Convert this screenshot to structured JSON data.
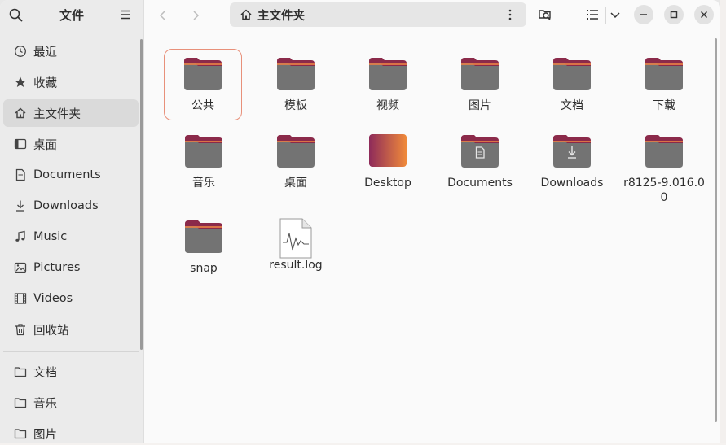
{
  "sidebar": {
    "title": "文件",
    "places": [
      {
        "label": "最近",
        "icon": "clock-icon"
      },
      {
        "label": "收藏",
        "icon": "star-icon"
      },
      {
        "label": "主文件夹",
        "icon": "home-icon",
        "active": true
      },
      {
        "label": "桌面",
        "icon": "desktop-icon"
      },
      {
        "label": "Documents",
        "icon": "document-icon"
      },
      {
        "label": "Downloads",
        "icon": "download-icon"
      },
      {
        "label": "Music",
        "icon": "music-icon"
      },
      {
        "label": "Pictures",
        "icon": "picture-icon"
      },
      {
        "label": "Videos",
        "icon": "video-icon"
      },
      {
        "label": "回收站",
        "icon": "trash-icon"
      }
    ],
    "bookmarks": [
      {
        "label": "文档",
        "icon": "folder-icon"
      },
      {
        "label": "音乐",
        "icon": "folder-icon"
      },
      {
        "label": "图片",
        "icon": "folder-icon"
      }
    ]
  },
  "header": {
    "path": "主文件夹"
  },
  "files": [
    {
      "label": "公共",
      "type": "folder"
    },
    {
      "label": "模板",
      "type": "folder"
    },
    {
      "label": "视频",
      "type": "folder"
    },
    {
      "label": "图片",
      "type": "folder"
    },
    {
      "label": "文档",
      "type": "folder"
    },
    {
      "label": "下载",
      "type": "folder"
    },
    {
      "label": "音乐",
      "type": "folder"
    },
    {
      "label": "桌面",
      "type": "folder"
    },
    {
      "label": "Desktop",
      "type": "folder-desktop"
    },
    {
      "label": "Documents",
      "type": "folder-documents"
    },
    {
      "label": "Downloads",
      "type": "folder-downloads"
    },
    {
      "label": "r8125-9.016.00",
      "type": "folder"
    },
    {
      "label": "snap",
      "type": "folder"
    },
    {
      "label": "result.log",
      "type": "log-file"
    }
  ],
  "colors": {
    "folder_body": "#737373",
    "folder_tab": "#8b2a4a",
    "selection_border": "#e8907a",
    "desktop_gradient_start": "#8e2b5a",
    "desktop_gradient_end": "#f08a3a"
  }
}
